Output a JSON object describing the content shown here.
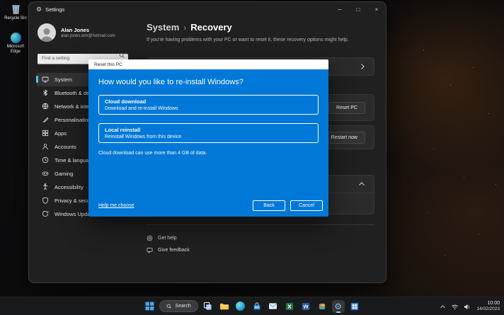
{
  "desktop": {
    "icons": [
      {
        "label": "Recycle Bin"
      },
      {
        "label": "Microsoft Edge"
      }
    ]
  },
  "settings_window": {
    "title": "Settings",
    "caption": {
      "minimize": "─",
      "maximize": "□",
      "close": "×"
    },
    "user": {
      "name": "Alan Jones",
      "email": "alan.jones.wm@hotmail.com"
    },
    "search": {
      "placeholder": "Find a setting"
    },
    "nav": [
      {
        "label": "System"
      },
      {
        "label": "Bluetooth & devices"
      },
      {
        "label": "Network & internet"
      },
      {
        "label": "Personalisation"
      },
      {
        "label": "Apps"
      },
      {
        "label": "Accounts"
      },
      {
        "label": "Time & language"
      },
      {
        "label": "Gaming"
      },
      {
        "label": "Accessibility"
      },
      {
        "label": "Privacy & security"
      },
      {
        "label": "Windows Update"
      }
    ],
    "page": {
      "breadcrumb_root": "System",
      "breadcrumb_sep": "›",
      "breadcrumb_current": "Recovery",
      "description": "If you're having problems with your PC or want to reset it, these recovery options might help.",
      "reset_pc_button": "Reset PC",
      "restart_now_button": "Restart now",
      "get_help": "Get help",
      "give_feedback": "Give feedback"
    }
  },
  "dialog": {
    "title": "Reset this PC",
    "heading": "How would you like to re-install Windows?",
    "accent_color": "#0078d7",
    "options": [
      {
        "title": "Cloud download",
        "subtitle": "Download and re-install Windows"
      },
      {
        "title": "Local reinstall",
        "subtitle": "Reinstall Windows from this device"
      }
    ],
    "note": "Cloud download can use more than 4 GB of data.",
    "help_link": "Help me choose",
    "back_button": "Back",
    "cancel_button": "Cancel"
  },
  "taskbar": {
    "search_label": "Search",
    "icons": [
      "start-icon",
      "search-icon",
      "task-view-icon",
      "file-explorer-icon",
      "edge-icon",
      "store-icon",
      "mail-icon",
      "excel-icon",
      "word-icon",
      "photos-icon",
      "settings-icon",
      "windows-app-icon"
    ],
    "tray_icons": [
      "chevron-up-icon",
      "network-icon",
      "volume-icon"
    ],
    "clock": {
      "time": "10:00",
      "date": "14/02/2023"
    }
  }
}
